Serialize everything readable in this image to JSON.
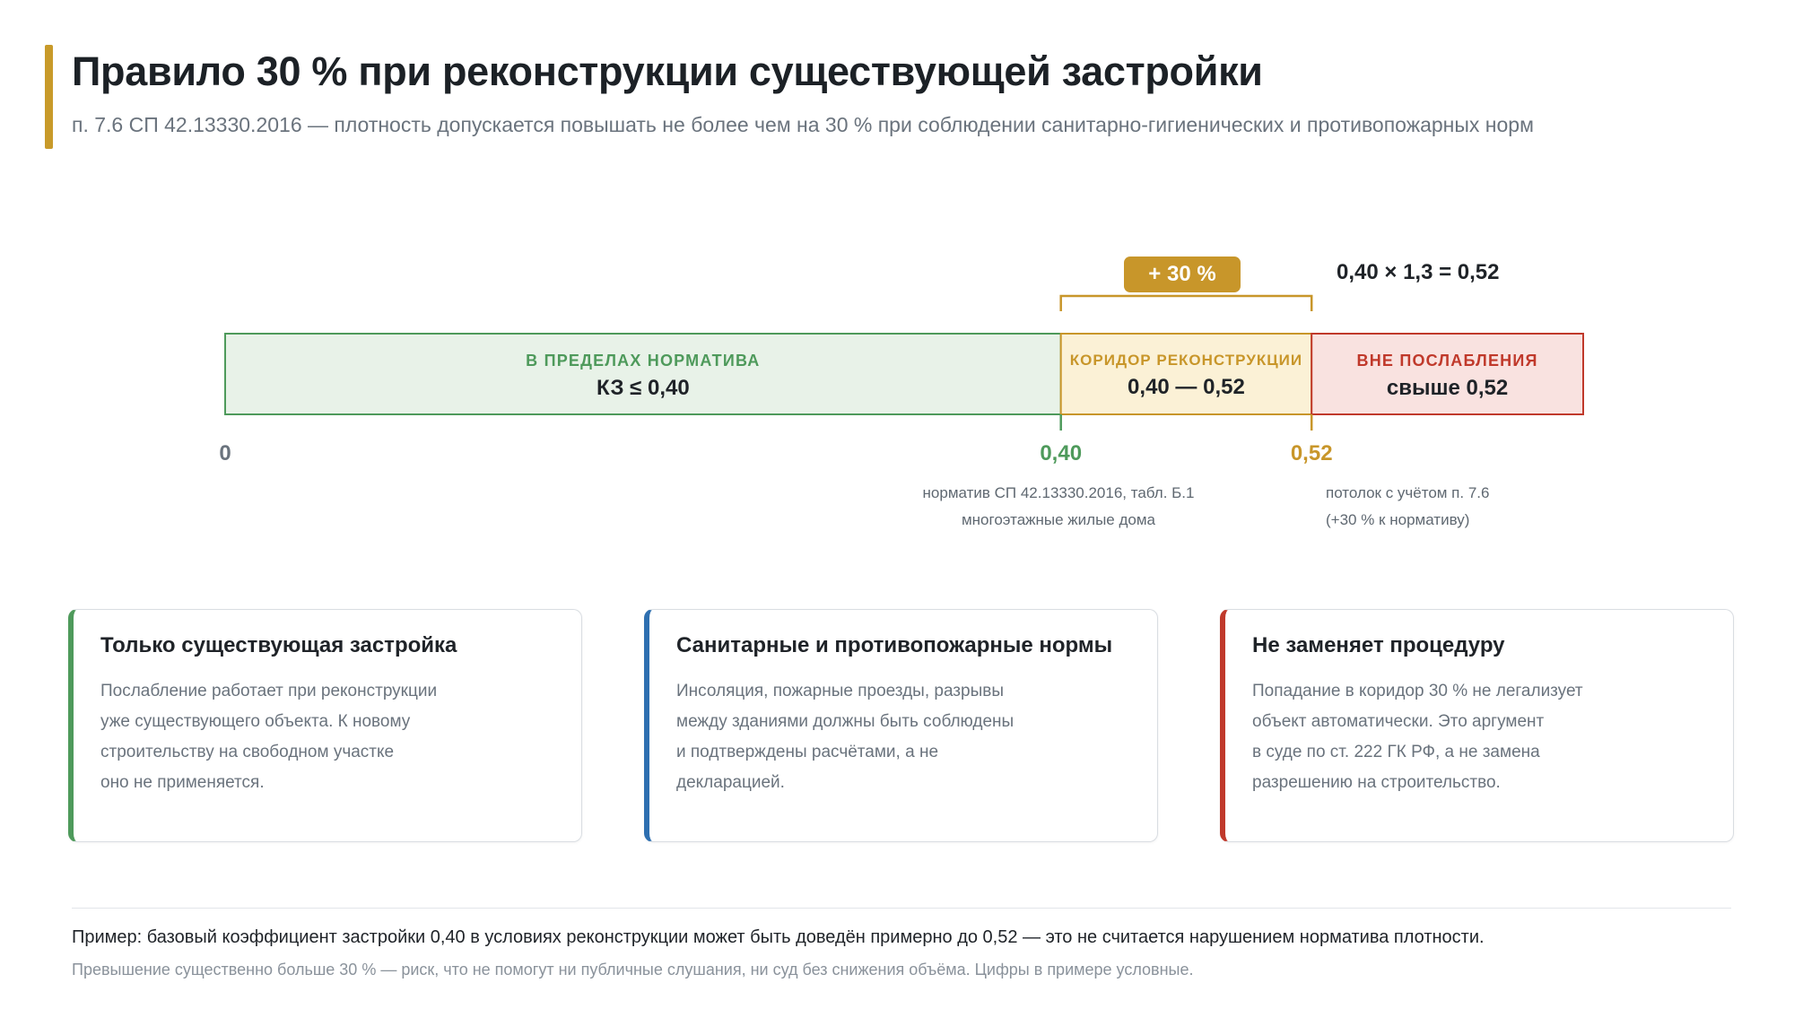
{
  "header": {
    "title": "Правило 30 % при реконструкции существующей застройки",
    "subtitle": "п. 7.6 СП 42.13330.2016 — плотность допускается повышать не более чем на 30 % при соблюдении санитарно-гигиенических и противопожарных норм"
  },
  "colors": {
    "accent": "#c89a2a",
    "green": "#4e9a5b",
    "gold": "#c8962a",
    "red": "#c0392b",
    "blue": "#2e6fb0"
  },
  "scale": {
    "min": 0,
    "max": 0.65,
    "norm": 0.4,
    "ceiling": 0.52,
    "segments": [
      {
        "label": "В ПРЕДЕЛАХ НОРМАТИВА",
        "value": "КЗ ≤ 0,40",
        "from": 0,
        "to": 0.4
      },
      {
        "label": "КОРИДОР РЕКОНСТРУКЦИИ",
        "value": "0,40 — 0,52",
        "from": 0.4,
        "to": 0.52
      },
      {
        "label": "ВНЕ ПОСЛАБЛЕНИЯ",
        "value": "свыше 0,52",
        "from": 0.52,
        "to": 0.65
      }
    ],
    "ticks": [
      {
        "value": 0,
        "label": "0"
      },
      {
        "value": 0.4,
        "label": "0,40"
      },
      {
        "value": 0.52,
        "label": "0,52"
      }
    ],
    "bracket_label": "+ 30 %",
    "formula": "0,40 × 1,3 = 0,52",
    "note_norm": {
      "line1": "норматив СП 42.13330.2016, табл. Б.1",
      "line2": "многоэтажные жилые дома"
    },
    "note_ceiling": {
      "line1": "потолок с учётом п. 7.6",
      "line2": "(+30 % к нормативу)"
    }
  },
  "cards": [
    {
      "title": "Только существующая застройка",
      "text": "Послабление работает при реконструкции\nуже существующего объекта. К новому\nстроительству на свободном участке\nоно не применяется."
    },
    {
      "title": "Санитарные и противопожарные нормы",
      "text": "Инсоляция, пожарные проезды, разрывы\nмежду зданиями должны быть соблюдены\nи подтверждены расчётами, а не\nдекларацией."
    },
    {
      "title": "Не заменяет процедуру",
      "text": "Попадание в коридор 30 % не легализует\nобъект автоматически. Это аргумент\nв суде по ст. 222 ГК РФ, а не замена\nразрешению на строительство."
    }
  ],
  "footer": {
    "main": "Пример: базовый коэффициент застройки 0,40 в условиях реконструкции может быть доведён примерно до 0,52 — это не считается нарушением норматива плотности.",
    "note": "Превышение существенно больше 30 % — риск, что не помогут ни публичные слушания, ни суд без снижения объёма. Цифры в примере условные."
  }
}
